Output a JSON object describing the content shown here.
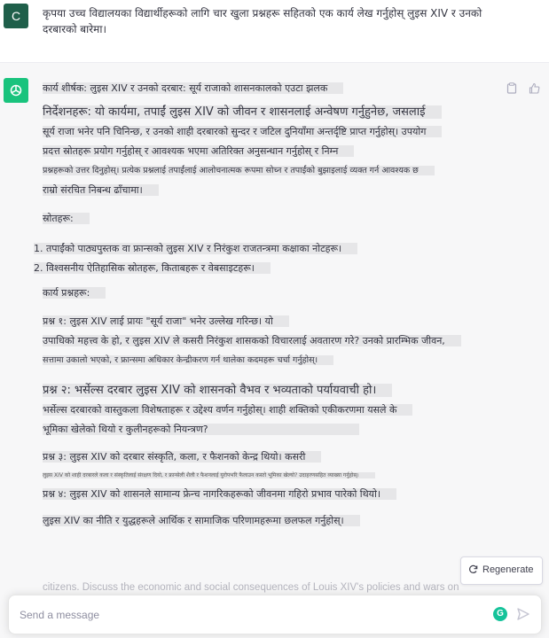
{
  "user_message": {
    "avatar_letter": "C",
    "text": "कृपया उच्च विद्यालयका विद्यार्थीहरूको लागि चार खुला प्रश्नहरू सहितको एक कार्य लेख गर्नुहोस् लुइस XIV र उनको दरबारको बारेमा।"
  },
  "assistant": {
    "avatar_icon": "openai-logo-icon",
    "actions": [
      "clipboard-icon",
      "thumbs-up-icon"
    ],
    "title": "कार्य शीर्षक: लुइस XIV र उनको दरबार: सूर्य राजाको शासनकालको एउटा झलक",
    "instructions_line1": "निर्देशनहरू: यो कार्यमा, तपाईं लुइस XIV को जीवन र शासनलाई अन्वेषण गर्नुहुनेछ, जसलाई",
    "instructions_line2": "सूर्य राजा भनेर पनि चिनिन्छ, र उनको शाही दरबारको सुन्दर र जटिल दुनियाँमा अन्तर्दृष्टि प्राप्त गर्नुहोस्। उपयोग",
    "instructions_line3": "प्रदत्त स्रोतहरू प्रयोग गर्नुहोस् र आवश्यक भएमा अतिरिक्त अनुसन्धान गर्नुहोस् र निम्न",
    "instructions_line4": "प्रश्नहरूको उत्तर दिनुहोस्। प्रत्येक प्रश्नलाई तपाईंलाई आलोचनात्मक रूपमा सोच्न र तपाईंको बुझाइलाई व्यक्त गर्न आवश्यक छ",
    "instructions_line5": "राम्रो संरचित निबन्ध ढाँचामा।",
    "sources_heading": "स्रोतहरू:",
    "sources": [
      "1. तपाईंको पाठ्यपुस्तक वा फ्रान्सको लुइस XIV र निरंकुश राजतन्त्रमा कक्षाका नोटहरू।",
      "2. विश्वसनीय ऐतिहासिक स्रोतहरू, किताबहरू र वेबसाइटहरू।"
    ],
    "questions_heading": "कार्य प्रश्नहरू:",
    "q1_line1": "प्रश्न १: लुइस XIV लाई प्रायः \"सूर्य राजा\" भनेर उल्लेख गरिन्छ। यो",
    "q1_line2": "उपाधिको महत्त्व के हो, र लुइस XIV ले कसरी निरंकुश शासकको विचारलाई अवतारण गरे? उनको प्रारम्भिक जीवन,",
    "q1_line3": "सत्तामा उकालो भएको, र फ्रान्समा अधिकार केन्द्रीकरण गर्न थालेका कदमहरू चर्चा गर्नुहोस्।",
    "q2_line1": "प्रश्न २: भर्सेल्स दरबार लुइस XIV को शासनको वैभव र भव्यताको पर्यायवाची हो।",
    "q2_line2": "भर्सेल्स दरबारको वास्तुकला विशेषताहरू र उद्देश्य वर्णन गर्नुहोस्। शाही शक्तिको एकीकरणमा यसले के",
    "q2_line3": "भूमिका खेलेको थियो र कुलीनहरूको नियन्त्रण?",
    "q3_line1": "प्रश्न ३: लुइस XIV को दरबार संस्कृति, कला, र फैशनको केन्द्र थियो। कसरी",
    "q3_line2": "लुइस XIV को शाही दरबारले कला र संस्कृतिलाई संरक्षण दियो, र फ्रान्सेली शैली र फैशनलाई युरोपभरि फैलाउन कस्तो भूमिका खेल्यो? उदाहरणसहित व्याख्या गर्नुहोस्।",
    "q4_line1": "प्रश्न ४: लुइस XIV को शासनले सामान्य फ्रेन्च नागरिकहरूको जीवनमा गहिरो प्रभाव पारेको थियो।",
    "q4_line2": "लुइस XIV का नीति र युद्धहरूले आर्थिक र सामाजिक परिणामहरूमा छलफल गर्नुहोस्।",
    "faded_text": "citizens. Discuss the economic and social consequences of Louis XIV's policies and wars on"
  },
  "regenerate_label": "Regenerate",
  "input": {
    "placeholder": "Send a message",
    "value": ""
  },
  "colors": {
    "user_avatar": "#1f5f4a",
    "assistant_avatar": "#19c37d",
    "assistant_bg": "#f7f7f8",
    "grammarly": "#15c39a"
  }
}
